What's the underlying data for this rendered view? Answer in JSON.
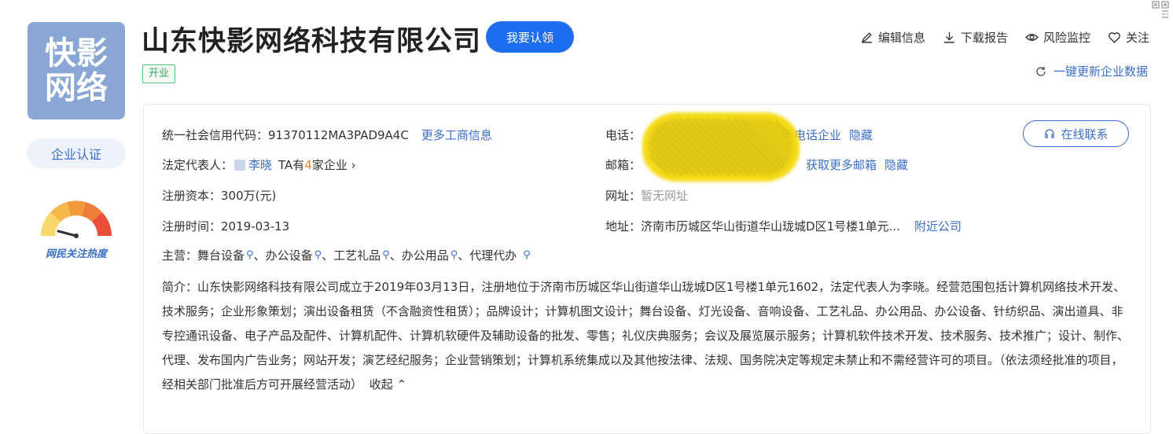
{
  "logo": {
    "line1": "快影",
    "line2": "网络"
  },
  "cert_label": "企业认证",
  "heat_label": "网民关注热度",
  "company": {
    "name": "山东快影网络科技有限公司",
    "claim_label": "我要认领",
    "status": "开业"
  },
  "actions": {
    "edit": "编辑信息",
    "download": "下载报告",
    "monitor": "风险监控",
    "follow": "关注"
  },
  "update_label": "一键更新企业数据",
  "info": {
    "credit_code_label": "统一社会信用代码：",
    "credit_code": "91370112MA3PAD9A4C",
    "more_biz_info": "更多工商信息",
    "legal_rep_label": "法定代表人：",
    "legal_rep": "李晓",
    "ta_prefix": "TA有",
    "ta_count": "4",
    "ta_suffix": "家企业 ›",
    "reg_capital_label": "注册资本：",
    "reg_capital": "300万(元)",
    "reg_time_label": "注册时间：",
    "reg_time": "2019-03-13",
    "phone_label": "电话：",
    "phone_same": "同电话企业",
    "phone_hide": "隐藏",
    "email_label": "邮箱：",
    "email_more": "获取更多邮箱",
    "email_hide": "隐藏",
    "website_label": "网址：",
    "website": "暂无网址",
    "address_label": "地址：",
    "address": "济南市历城区华山街道华山珑城D区1号楼1单元...",
    "nearby": "附近公司",
    "contact_btn": "在线联系",
    "main_label": "主营：",
    "main_items": [
      "舞台设备",
      "办公设备",
      "工艺礼品",
      "办公用品",
      "代理代办"
    ]
  },
  "intro": {
    "text": "简介：山东快影网络科技有限公司成立于2019年03月13日，注册地位于济南市历城区华山街道华山珑城D区1号楼1单元1602，法定代表人为李晓。经营范围包括计算机网络技术开发、技术服务；企业形象策划；演出设备租赁（不含融资性租赁）；品牌设计；计算机图文设计；舞台设备、灯光设备、音响设备、工艺礼品、办公用品、办公设备、针纺织品、演出道具、非专控通讯设备、电子产品及配件、计算机配件、计算机软硬件及辅助设备的批发、零售；礼仪庆典服务；会议及展览展示服务；计算机软件技术开发、技术服务、技术推广；设计、制作、代理、发布国内广告业务；网站开发；演艺经纪服务；企业营销策划；计算机系统集成以及其他按法律、法规、国务院决定等规定未禁止和不需经营许可的项目。（依法须经批准的项目，经相关部门批准后方可开展经营活动）",
    "collapse": "收起 ⌃"
  }
}
